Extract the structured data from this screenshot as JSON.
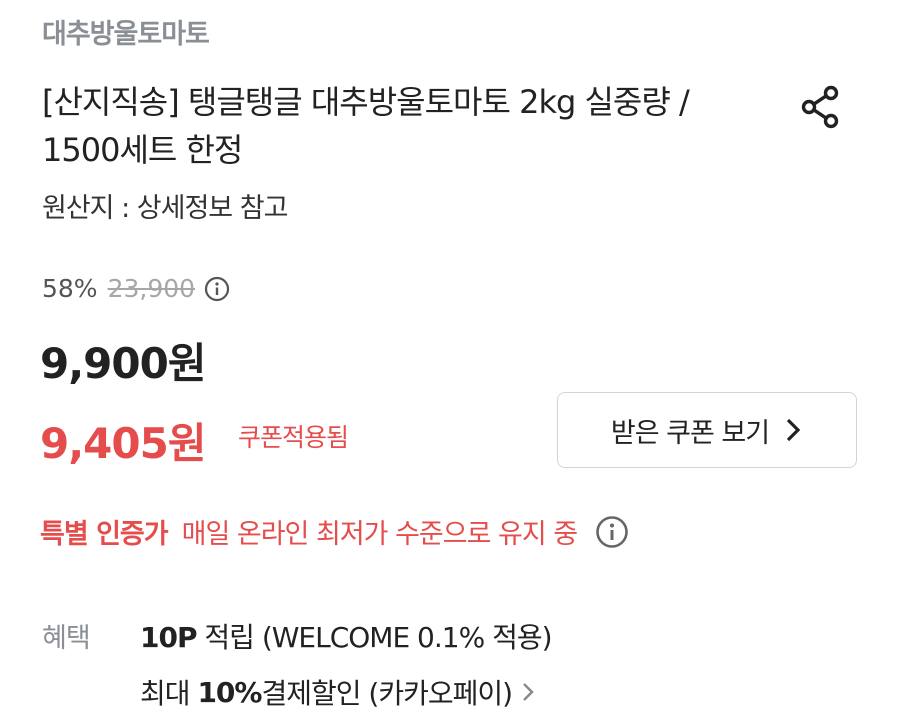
{
  "store": {
    "name": "대추방울토마토"
  },
  "product": {
    "title": "[산지직송] 탱글탱글 대추방울토마토 2kg 실중량 / 1500세트 한정",
    "origin": "원산지 : 상세정보 참고"
  },
  "pricing": {
    "discount_rate": "58%",
    "original_price": "23,900",
    "price": "9,900원",
    "coupon_price": "9,405원",
    "coupon_applied_label": "쿠폰적용됨",
    "coupon_button_label": "받은 쿠폰 보기"
  },
  "lowest_price": {
    "badge": "특별 인증가",
    "text": "매일 온라인 최저가 수준으로 유지 중"
  },
  "benefits": {
    "label": "혜택",
    "point_bold": "10P",
    "point_text": " 적립 (WELCOME 0.1% 적용)",
    "discount_prefix": "최대 ",
    "discount_bold": "10%",
    "discount_text": " 결제할인 (카카오페이)"
  },
  "colors": {
    "accent_red": "#e54d4d",
    "muted_gray": "#8a8f96"
  },
  "icons": {
    "share": "share-icon",
    "info": "info-icon",
    "chevron": "chevron-right-icon"
  }
}
